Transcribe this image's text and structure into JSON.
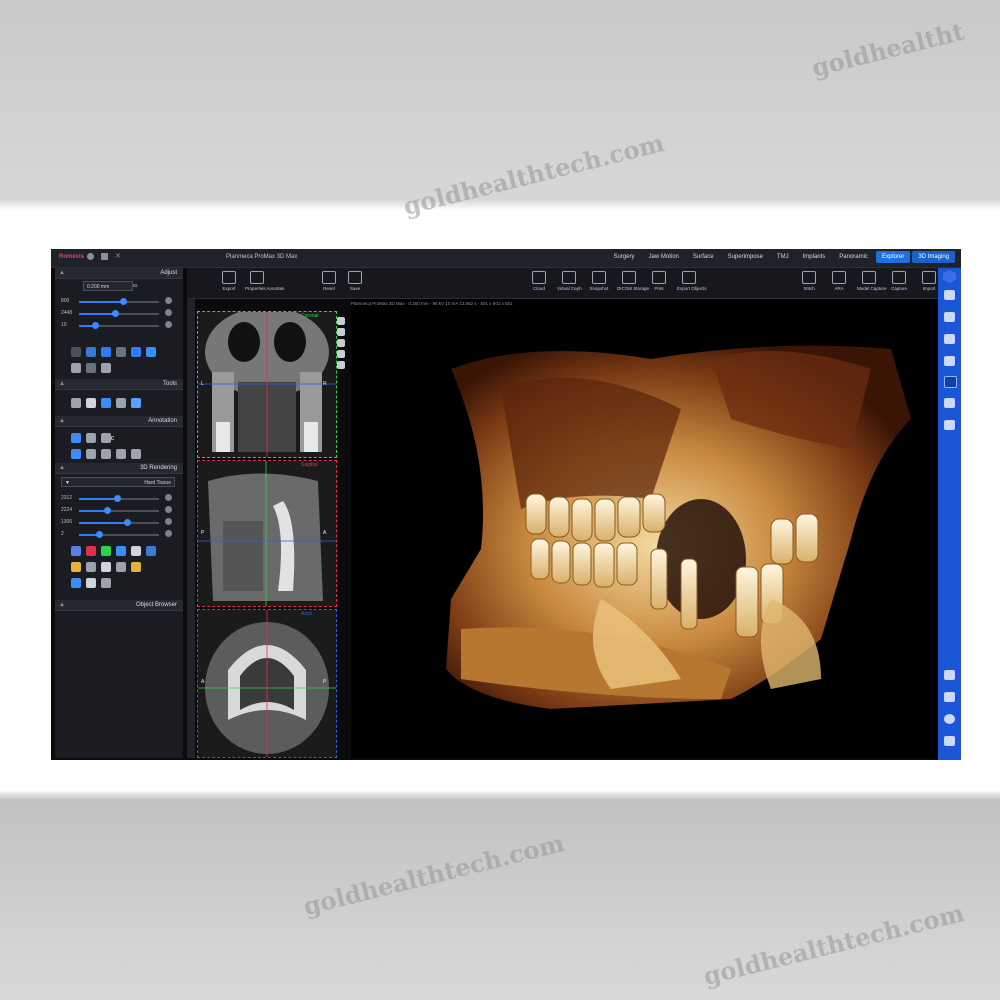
{
  "watermark": {
    "text": "goldhealthtech.com",
    "partial_text": "goldhealtht"
  },
  "app": {
    "brand": "Romexis",
    "title": "Planmeca ProMax 3D Max"
  },
  "tabs": [
    "Surgery",
    "Jaw Motion",
    "Surface",
    "Superimpose",
    "TMJ",
    "Implants",
    "Panoramic",
    "Explorer",
    "3D Imaging"
  ],
  "active_tab": "Explorer",
  "toolbar": {
    "left": [
      {
        "label": "Export",
        "icon": "export-icon"
      },
      {
        "label": "Properties Annotate",
        "icon": "properties-icon"
      },
      {
        "label": "Reset",
        "icon": "reset-icon"
      },
      {
        "label": "Save",
        "icon": "save-icon"
      }
    ],
    "mid": [
      {
        "label": "Cloud",
        "icon": "cloud-icon"
      },
      {
        "label": "Virtual Ceph",
        "icon": "ceph-icon"
      },
      {
        "label": "Snapshot",
        "icon": "snapshot-icon"
      },
      {
        "label": "DICOM Storage",
        "icon": "dicom-icon"
      },
      {
        "label": "Print",
        "icon": "print-icon"
      },
      {
        "label": "Export Objects",
        "icon": "export-objects-icon"
      }
    ],
    "right": [
      {
        "label": "Stitch",
        "icon": "stitch-icon"
      },
      {
        "label": "ARA",
        "icon": "ara-icon"
      },
      {
        "label": "Model Capture",
        "icon": "model-capture-icon"
      },
      {
        "label": "Capture",
        "icon": "capture-icon"
      },
      {
        "label": "Import",
        "icon": "import-icon"
      }
    ]
  },
  "info_line": "Planmeca ProMax 3D Max - 0.250 mm - 96 kV 10 mA 12.052 s - 501 x 501 x 501",
  "left_panel": {
    "adjust": {
      "header": "Adjust",
      "thickness_label": "Thickness",
      "thickness_value": "0.200 mm",
      "sliders": [
        {
          "label": "800",
          "value": 0.55
        },
        {
          "label": "2448",
          "value": 0.45
        },
        {
          "label": "10",
          "value": 0.2
        }
      ]
    },
    "tools": {
      "header": "Tools"
    },
    "annotation": {
      "header": "Annotation",
      "text_tool": "abc"
    },
    "rendering": {
      "header": "3D Rendering",
      "preset": "Hard Tissue",
      "sliders": [
        {
          "label": "2312",
          "value": 0.48
        },
        {
          "label": "2224",
          "value": 0.35
        },
        {
          "label": "1306",
          "value": 0.6
        },
        {
          "label": "2",
          "value": 0.25
        }
      ]
    },
    "object_browser": {
      "header": "Object Browser"
    }
  },
  "slices": [
    {
      "name": "Coronal",
      "color": "#2fd34a",
      "labels": [
        "L",
        "R"
      ]
    },
    {
      "name": "Sagittal",
      "color": "#e0304a",
      "labels": [
        "P",
        "A"
      ]
    },
    {
      "name": "Axial",
      "color": "#2d5fe8",
      "labels": [
        "A",
        "P"
      ]
    }
  ],
  "colors": {
    "accent": "#1e6fe0",
    "rightbar": "#1a56d6",
    "brand": "#e0456b"
  }
}
